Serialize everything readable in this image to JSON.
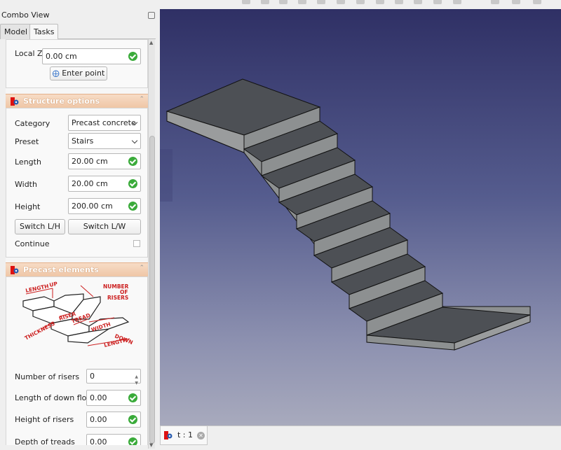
{
  "combo_view": {
    "title": "Combo View",
    "tabs": [
      {
        "label": "Model"
      },
      {
        "label": "Tasks"
      }
    ]
  },
  "point_section": {
    "local_z_label": "Local Z",
    "local_z_value": "0.00 cm",
    "enter_point_label": "Enter point"
  },
  "structure_options": {
    "header": "Structure options",
    "category_label": "Category",
    "category_value": "Precast concrete",
    "preset_label": "Preset",
    "preset_value": "Stairs",
    "length_label": "Length",
    "length_value": "20.00 cm",
    "width_label": "Width",
    "width_value": "20.00 cm",
    "height_label": "Height",
    "height_value": "200.00 cm",
    "switch_lh_label": "Switch L/H",
    "switch_lw_label": "Switch L/W",
    "continue_label": "Continue"
  },
  "precast_elements": {
    "header": "Precast elements",
    "diagram_labels": [
      "LENGTH",
      "UP",
      "NUMBER",
      "OF",
      "RISERS",
      "RISER",
      "TREAD",
      "THICKNESS",
      "WIDTH",
      "DOWN",
      "LENGTH"
    ],
    "number_of_risers_label": "Number of risers",
    "number_of_risers_value": "0",
    "down_floor_label": "Length of down floor",
    "down_floor_value": "0.00",
    "height_of_risers_label": "Height of risers",
    "height_of_risers_value": "0.00",
    "depth_of_treads_label": "Depth of treads",
    "depth_of_treads_value": "0.00"
  },
  "document_tab": {
    "name": "t : 1"
  },
  "colors": {
    "section_header": "#efc6a6",
    "valid_check": "#3aab3a",
    "viewport_top": "#2f3065",
    "viewport_bottom": "#a8aabd",
    "stair_top_face": "#4d5055",
    "stair_side_face": "#8d9091",
    "diagram_red": "#cc1f1f"
  }
}
